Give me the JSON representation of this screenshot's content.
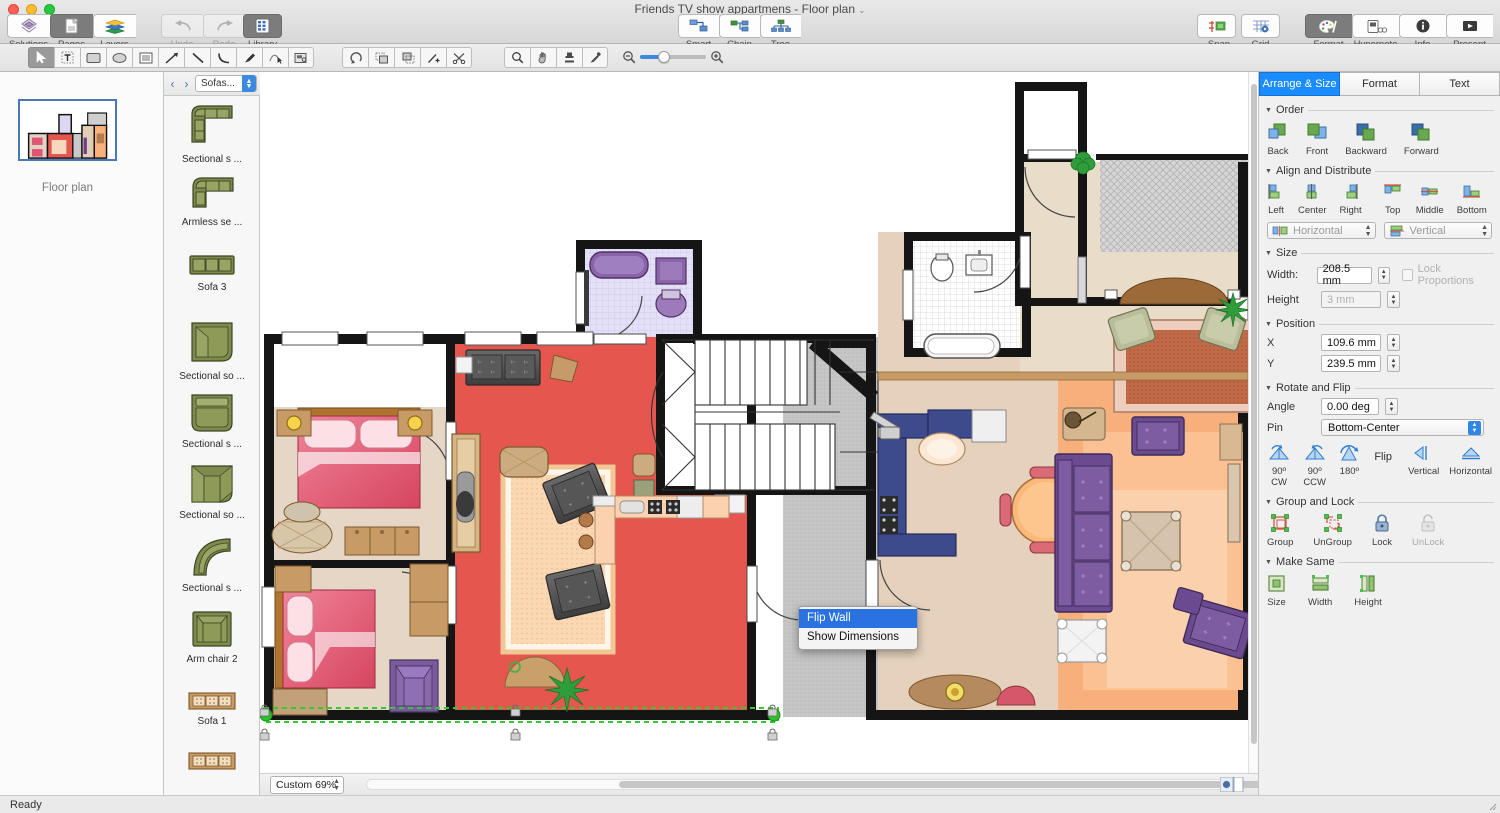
{
  "window": {
    "title": "Friends TV show appartmens - Floor plan",
    "title_chevron": "⌄"
  },
  "toolbar": {
    "left_group": [
      {
        "label": "Solutions",
        "icon": "solutions-icon",
        "state": "off"
      },
      {
        "label": "Pages",
        "icon": "pages-icon",
        "state": "on"
      },
      {
        "label": "Layers",
        "icon": "layers-icon",
        "state": "off"
      }
    ],
    "history_group": [
      {
        "label": "Undo",
        "icon": "undo-arrow-icon",
        "state": "disabled"
      },
      {
        "label": "Redo",
        "icon": "redo-arrow-icon",
        "state": "disabled"
      }
    ],
    "library_group": [
      {
        "label": "Library",
        "icon": "library-icon",
        "state": "on"
      }
    ],
    "connector_group": [
      {
        "label": "Smart",
        "icon": "smart-connector-icon",
        "state": "off"
      },
      {
        "label": "Chain",
        "icon": "chain-connector-icon",
        "state": "off"
      },
      {
        "label": "Tree",
        "icon": "tree-connector-icon",
        "state": "off"
      }
    ],
    "grid_group": [
      {
        "label": "Snap",
        "icon": "snap-icon",
        "state": "off"
      },
      {
        "label": "Grid",
        "icon": "grid-icon",
        "state": "off"
      }
    ],
    "inspector_group": [
      {
        "label": "Format",
        "icon": "format-palette-icon",
        "state": "on"
      },
      {
        "label": "Hypernote",
        "icon": "hypernote-icon",
        "state": "off"
      },
      {
        "label": "Info",
        "icon": "info-icon",
        "state": "off"
      },
      {
        "label": "Present",
        "icon": "present-icon",
        "state": "off"
      }
    ]
  },
  "drawbar": {
    "tools": [
      {
        "name": "select-tool",
        "state": "on"
      },
      {
        "name": "text-tool",
        "state": "off"
      },
      {
        "name": "rectangle-tool",
        "state": "off"
      },
      {
        "name": "ellipse-tool",
        "state": "off"
      },
      {
        "name": "frame-tool",
        "state": "off"
      },
      {
        "name": "arrow-tool",
        "state": "off"
      },
      {
        "name": "line-tool",
        "state": "off"
      },
      {
        "name": "curve-tool",
        "state": "off"
      },
      {
        "name": "pen-tool",
        "state": "off"
      },
      {
        "name": "bezier-edit-tool",
        "state": "off"
      },
      {
        "name": "callout-tool",
        "state": "off"
      }
    ],
    "edit_tools": [
      {
        "name": "rotate-tool",
        "state": "off"
      },
      {
        "name": "duplicate-tool",
        "state": "off"
      },
      {
        "name": "stamp-tool",
        "state": "off"
      },
      {
        "name": "add-point-tool",
        "state": "off"
      },
      {
        "name": "scissors-tool",
        "state": "off"
      }
    ],
    "view_tools": [
      {
        "name": "zoom-tool",
        "state": "off"
      },
      {
        "name": "hand-tool",
        "state": "off"
      },
      {
        "name": "fill-tool",
        "state": "off"
      },
      {
        "name": "eyedropper-tool",
        "state": "off"
      }
    ]
  },
  "pages": {
    "items": [
      {
        "label": "Floor plan",
        "selected": true
      }
    ]
  },
  "library": {
    "category": "Sofas...",
    "prev_label": "‹",
    "next_label": "›",
    "items": [
      {
        "label": "Sectional s ...",
        "shape": "sectional-sofa-l-left"
      },
      {
        "label": "Armless se ...",
        "shape": "armless-sectional"
      },
      {
        "label": "Sofa 3",
        "shape": "sofa-three-seat"
      },
      {
        "label": "Sectional so ...",
        "shape": "sectional-corner-right"
      },
      {
        "label": "Sectional s ...",
        "shape": "sectional-loveseat"
      },
      {
        "label": "Sectional so ...",
        "shape": "sectional-corner-wedge"
      },
      {
        "label": "Sectional s ...",
        "shape": "sectional-curved"
      },
      {
        "label": "Arm chair 2",
        "shape": "arm-chair"
      },
      {
        "label": "Sofa 1",
        "shape": "sofa-wicker-long"
      },
      {
        "label": "",
        "shape": "sofa-wicker-long-2"
      }
    ]
  },
  "canvas": {
    "zoom_value": "Custom 69%",
    "context_menu": {
      "items": [
        {
          "label": "Flip Wall",
          "selected": true
        },
        {
          "label": "Show Dimensions",
          "selected": false
        }
      ]
    }
  },
  "inspector": {
    "tabs": [
      {
        "label": "Arrange & Size",
        "active": true
      },
      {
        "label": "Format",
        "active": false
      },
      {
        "label": "Text",
        "active": false
      }
    ],
    "order": {
      "title": "Order",
      "buttons": [
        {
          "label": "Back",
          "icon": "send-to-back-icon"
        },
        {
          "label": "Front",
          "icon": "bring-to-front-icon"
        },
        {
          "label": "Backward",
          "icon": "send-backward-icon"
        },
        {
          "label": "Forward",
          "icon": "bring-forward-icon"
        }
      ]
    },
    "align": {
      "title": "Align and Distribute",
      "buttons": [
        {
          "label": "Left",
          "icon": "align-left-icon"
        },
        {
          "label": "Center",
          "icon": "align-center-icon"
        },
        {
          "label": "Right",
          "icon": "align-right-icon"
        },
        {
          "label": "Top",
          "icon": "align-top-icon"
        },
        {
          "label": "Middle",
          "icon": "align-middle-icon"
        },
        {
          "label": "Bottom",
          "icon": "align-bottom-icon"
        }
      ],
      "distribute_horizontal": "Horizontal",
      "distribute_vertical": "Vertical"
    },
    "size": {
      "title": "Size",
      "width_label": "Width:",
      "width_value": "208.5 mm",
      "height_label": "Height",
      "height_value": "3 mm",
      "lock_proportions_label": "Lock Proportions",
      "lock_proportions_checked": false
    },
    "position": {
      "title": "Position",
      "x_label": "X",
      "x_value": "109.6 mm",
      "y_label": "Y",
      "y_value": "239.5 mm"
    },
    "rotate": {
      "title": "Rotate and Flip",
      "angle_label": "Angle",
      "angle_value": "0.00 deg",
      "pin_label": "Pin",
      "pin_value": "Bottom-Center",
      "buttons": [
        {
          "label": "90º CW",
          "icon": "rotate-cw-icon"
        },
        {
          "label": "90º CCW",
          "icon": "rotate-ccw-icon"
        },
        {
          "label": "180º",
          "icon": "rotate-180-icon"
        }
      ],
      "flip_label": "Flip",
      "flip_buttons": [
        {
          "label": "Vertical",
          "icon": "flip-vertical-icon"
        },
        {
          "label": "Horizontal",
          "icon": "flip-horizontal-icon"
        }
      ]
    },
    "group": {
      "title": "Group and Lock",
      "buttons": [
        {
          "label": "Group",
          "icon": "group-icon"
        },
        {
          "label": "UnGroup",
          "icon": "ungroup-icon"
        },
        {
          "label": "Lock",
          "icon": "lock-icon"
        },
        {
          "label": "UnLock",
          "icon": "unlock-icon"
        }
      ]
    },
    "make_same": {
      "title": "Make Same",
      "buttons": [
        {
          "label": "Size",
          "icon": "same-size-icon"
        },
        {
          "label": "Width",
          "icon": "same-width-icon"
        },
        {
          "label": "Height",
          "icon": "same-height-icon"
        }
      ]
    }
  },
  "status": {
    "message": "Ready"
  },
  "colors": {
    "accent": "#1a8cff",
    "selection_green": "#22c322",
    "living_room": "#e4564e",
    "bedroom": "#e3d3c4",
    "hall": "#e2cdb6",
    "lounge": "#f9b27c",
    "bathroom": "#ddd7f2",
    "stairs": "#c9c9c9"
  }
}
